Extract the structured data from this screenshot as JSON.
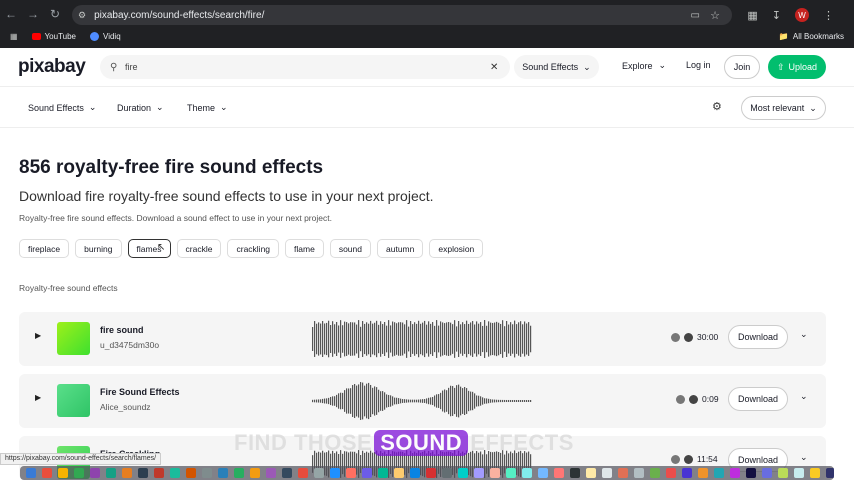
{
  "browser": {
    "url": "pixabay.com/sound-effects/search/fire/",
    "bookmarks": [
      "YouTube",
      "Vidiq"
    ],
    "all_bookmarks": "All Bookmarks",
    "avatar_letter": "W"
  },
  "header": {
    "logo": "pixabay",
    "search_query": "fire",
    "search_type": "Sound Effects",
    "explore": "Explore",
    "login": "Log in",
    "join": "Join",
    "upload": "Upload"
  },
  "filters": {
    "items": [
      "Sound Effects",
      "Duration",
      "Theme"
    ],
    "sort": "Most relevant"
  },
  "main": {
    "title": "856 royalty-free fire sound effects",
    "subtitle": "Download fire royalty-free sound effects to use in your next project.",
    "description": "Royalty-free fire sound effects. Download a sound effect to use in your next project.",
    "tags": [
      "fireplace",
      "burning",
      "flames",
      "crackle",
      "crackling",
      "flame",
      "sound",
      "autumn",
      "explosion"
    ],
    "section_label": "Royalty-free sound effects"
  },
  "tracks": [
    {
      "name": "fire sound",
      "user": "u_d3475dm30o",
      "duration": "30:00",
      "download": "Download",
      "thumb_color": "#6be22f"
    },
    {
      "name": "Fire Sound Effects",
      "user": "Alice_soundz",
      "duration": "0:09",
      "download": "Download",
      "thumb_color": "#3ecf6e"
    },
    {
      "name": "Fire Crackling",
      "user": "",
      "duration": "11:54",
      "download": "Download",
      "thumb_color": "#44d65c"
    }
  ],
  "overlay": {
    "pre": "FIND THOSE",
    "highlight": "SOUND",
    "post": "EFFECTS"
  },
  "status_link": "https://pixabay.com/sound-effects/search/flames/",
  "colors": {
    "brand_green": "#02be6e",
    "overlay_purple": "#7b10d6"
  }
}
